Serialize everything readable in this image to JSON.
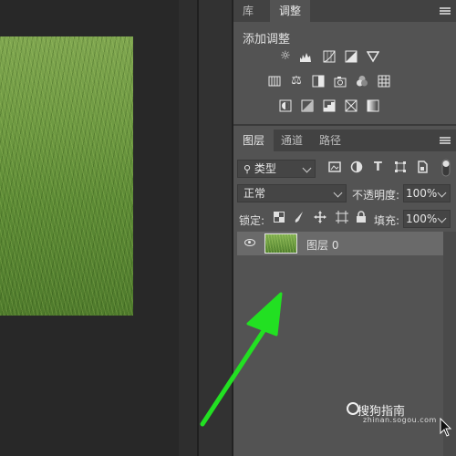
{
  "adjustments_panel": {
    "tabs": [
      "库",
      "调整"
    ],
    "active_tab": "调整",
    "add_adjustment_label": "添加调整",
    "icons_row1": [
      "brightness-contrast-icon",
      "levels-icon",
      "curves-icon",
      "exposure-icon",
      "vibrance-icon"
    ],
    "icons_row2": [
      "hue-saturation-icon",
      "color-balance-icon",
      "black-white-icon",
      "photo-filter-icon",
      "channel-mixer-icon",
      "color-lookup-icon"
    ],
    "icons_row3": [
      "invert-icon",
      "posterize-icon",
      "threshold-icon",
      "selective-color-icon",
      "gradient-map-icon"
    ]
  },
  "layers_panel": {
    "tabs": [
      "图层",
      "通道",
      "路径"
    ],
    "active_tab": "图层",
    "filter_kind": "类型",
    "blend_mode": "正常",
    "opacity_label": "不透明度:",
    "opacity_value": "100%",
    "lock_label": "锁定:",
    "fill_label": "填充:",
    "fill_value": "100%",
    "layers": [
      {
        "name": "图层 0",
        "visible": true,
        "selected": true
      }
    ]
  },
  "watermark": {
    "text": "搜狗指南",
    "url": "zhinan.sogou.com"
  },
  "colors": {
    "panel_bg": "#535353",
    "tab_bar_bg": "#424242",
    "selected_layer_bg": "#6a6a6a",
    "arrow_green": "#22e022"
  }
}
